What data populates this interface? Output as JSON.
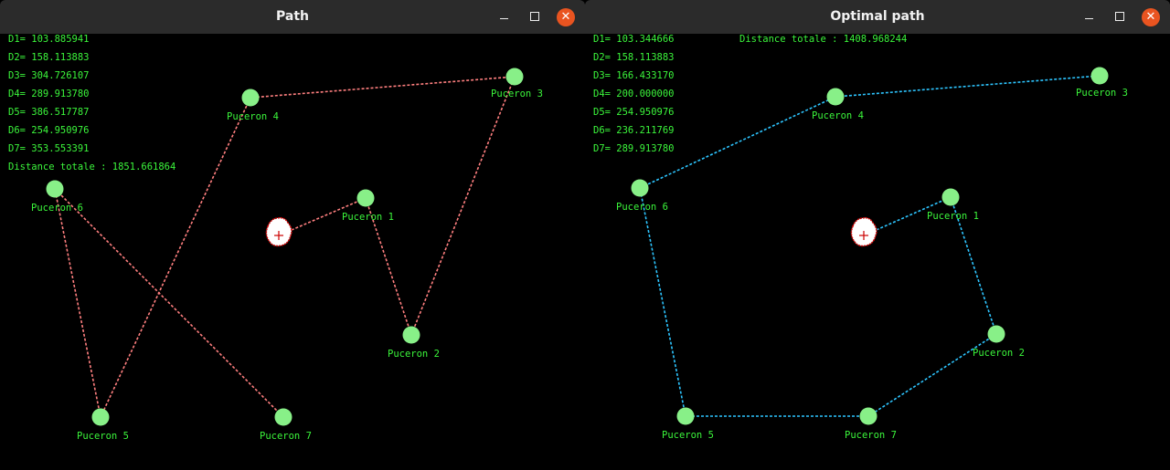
{
  "windows": {
    "left": {
      "title": "Path",
      "distances": [
        "D1= 103.885941",
        "D2= 158.113883",
        "D3= 304.726107",
        "D4= 289.913780",
        "D5= 386.517787",
        "D6= 254.950976",
        "D7= 353.553391"
      ],
      "total": "Distance totale : 1851.661864",
      "path_color": "#ff7f7f",
      "path": [
        0,
        1,
        2,
        3,
        4,
        5,
        6,
        7
      ]
    },
    "right": {
      "title": "Optimal path",
      "distances": [
        "D1= 103.344666",
        "D2= 158.113883",
        "D3= 166.433170",
        "D4= 200.000000",
        "D5= 254.950976",
        "D6= 236.211769",
        "D7= 289.913780"
      ],
      "total": "Distance totale : 1408.968244",
      "path_color": "#2dc5ff",
      "path": [
        0,
        1,
        2,
        7,
        5,
        6,
        4,
        3
      ]
    }
  },
  "nodes": [
    {
      "label": "Puceron 1"
    },
    {
      "label": "Puceron 2"
    },
    {
      "label": "Puceron 3"
    },
    {
      "label": "Puceron 4"
    },
    {
      "label": "Puceron 5"
    },
    {
      "label": "Puceron 6"
    },
    {
      "label": "Puceron 7"
    }
  ],
  "colors": {
    "node_fill": "#88f088",
    "label": "#3bf53b",
    "origin_fill": "#ffffff",
    "origin_outline": "#cc0000"
  },
  "icons": {
    "minimize": "minimize-icon",
    "maximize": "maximize-icon",
    "close": "close-icon"
  }
}
